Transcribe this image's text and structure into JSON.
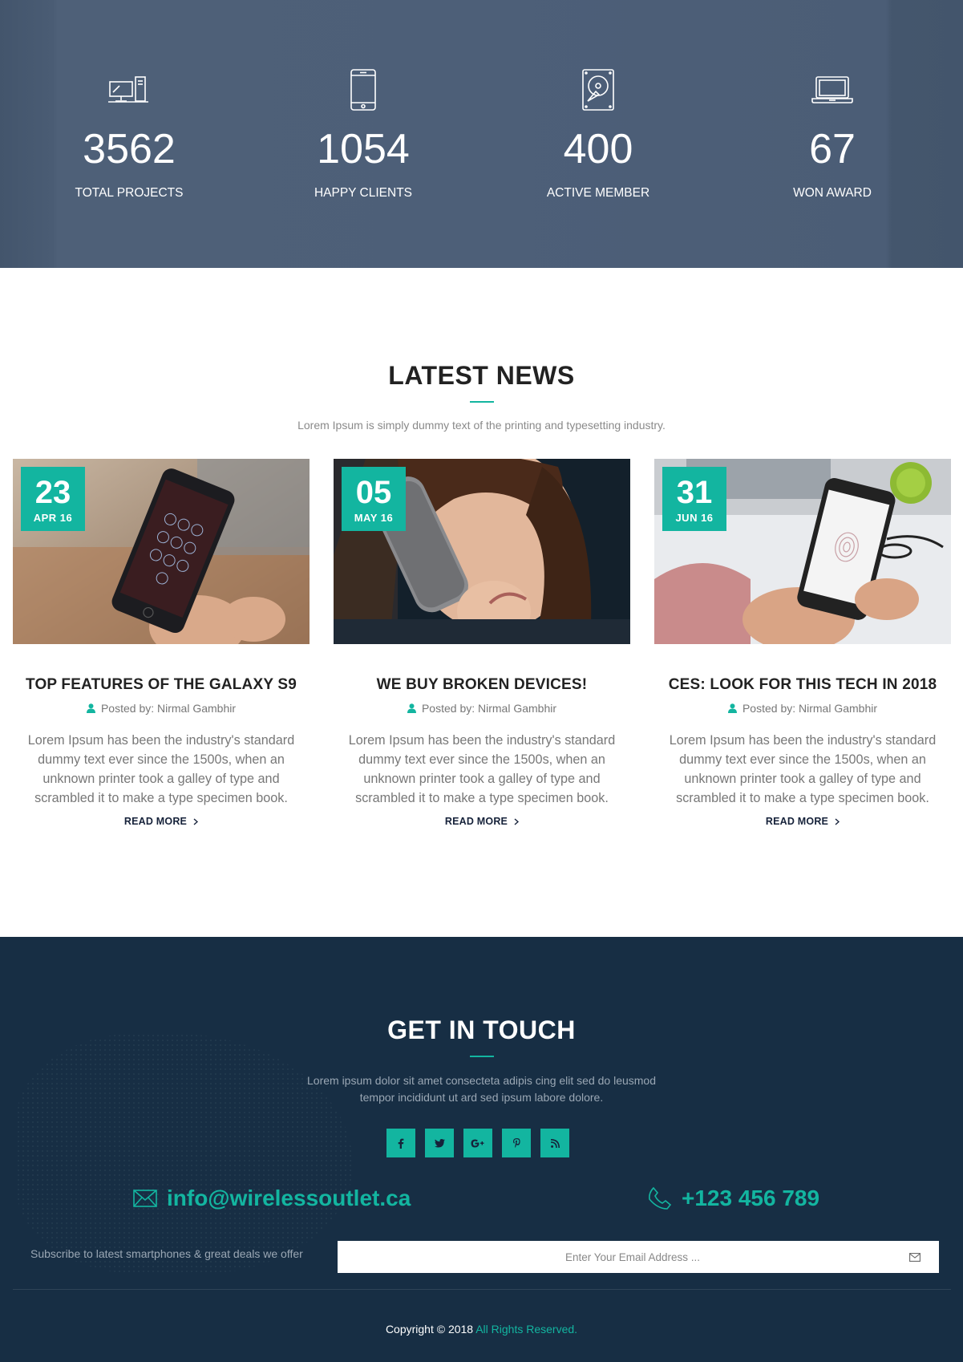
{
  "stats": [
    {
      "icon": "desktop-computer-icon",
      "value": "3562",
      "label": "TOTAL PROJECTS"
    },
    {
      "icon": "smartphone-icon",
      "value": "1054",
      "label": "HAPPY CLIENTS"
    },
    {
      "icon": "hard-drive-icon",
      "value": "400",
      "label": "ACTIVE MEMBER"
    },
    {
      "icon": "laptop-icon",
      "value": "67",
      "label": "WON AWARD"
    }
  ],
  "news": {
    "title": "LATEST NEWS",
    "subtitle": "Lorem Ipsum is simply dummy text of the printing and typesetting industry.",
    "posts": [
      {
        "day": "23",
        "month": "APR 16",
        "title": "TOP FEATURES OF THE GALAXY S9",
        "author": "Posted by: Nirmal Gambhir",
        "excerpt": "Lorem Ipsum has been the industry's standard dummy text ever since the 1500s, when an unknown printer took a galley of type and scrambled it to make a type specimen book.",
        "read_more": "READ MORE"
      },
      {
        "day": "05",
        "month": "MAY 16",
        "title": "WE BUY BROKEN DEVICES!",
        "author": "Posted by: Nirmal Gambhir",
        "excerpt": "Lorem Ipsum has been the industry's standard dummy text ever since the 1500s, when an unknown printer took a galley of type and scrambled it to make a type specimen book.",
        "read_more": "READ MORE"
      },
      {
        "day": "31",
        "month": "JUN 16",
        "title": "CES: LOOK FOR THIS TECH IN 2018",
        "author": "Posted by: Nirmal Gambhir",
        "excerpt": "Lorem Ipsum has been the industry's standard dummy text ever since the 1500s, when an unknown printer took a galley of type and scrambled it to make a type specimen book.",
        "read_more": "READ MORE"
      }
    ]
  },
  "contact": {
    "title": "GET IN TOUCH",
    "text": "Lorem ipsum dolor sit amet consecteta adipis cing elit sed do leusmod tempor incididunt ut ard sed ipsum labore dolore.",
    "social": [
      {
        "icon": "facebook-icon",
        "glyph": "f"
      },
      {
        "icon": "twitter-icon",
        "glyph": "t"
      },
      {
        "icon": "google-plus-icon",
        "glyph": "G+"
      },
      {
        "icon": "pinterest-icon",
        "glyph": "p"
      },
      {
        "icon": "rss-icon",
        "glyph": "rss"
      }
    ],
    "email": "info@wirelessoutlet.ca",
    "phone": "+123 456 789",
    "subscribe_label": "Subscribe to latest smartphones & great deals we offer",
    "subscribe_placeholder": "Enter Your Email Address ...",
    "copyright_prefix": "Copyright © 2018",
    "copyright_rights": "All Rights Reserved."
  },
  "colors": {
    "accent": "#13b5a0",
    "stats_bg": "#4d5f78",
    "footer_bg": "#172e44",
    "heading": "#222222"
  }
}
